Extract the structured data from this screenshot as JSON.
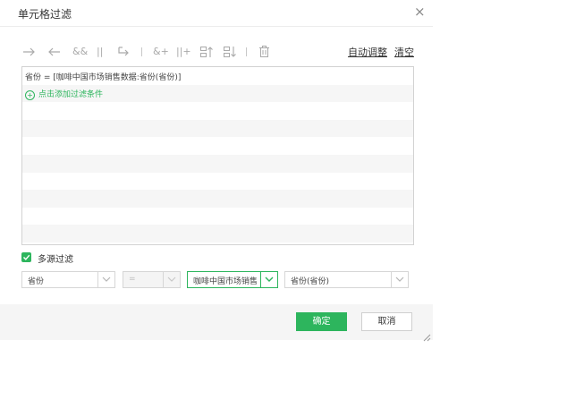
{
  "dialog": {
    "title": "单元格过滤",
    "close_glyph": "×"
  },
  "toolbar": {
    "icons": [
      "arrow-right-icon",
      "arrow-left-icon",
      "and-icon",
      "or-icon",
      "indent-icon",
      "add-and-icon",
      "add-or-icon",
      "move-up-icon",
      "move-down-icon",
      "delete-icon"
    ],
    "glyphs": {
      "and": "&&",
      "or": "||",
      "add_and": "&+",
      "add_or": "||+"
    },
    "auto_adjust": "自动调整",
    "clear": "清空"
  },
  "conditions": {
    "expression": "省份 = [咖啡中国市场销售数据:省份(省份)]",
    "add_link": "点击添加过滤条件"
  },
  "multi_source": {
    "label": "多源过滤",
    "checked": true
  },
  "filter_row": {
    "field": "省份",
    "operator": "=",
    "dataset": "咖啡中国市场销售",
    "dataset_field": "省份(省份)"
  },
  "buttons": {
    "ok": "确定",
    "cancel": "取消"
  },
  "colors": {
    "accent": "#2db55d",
    "icon": "#a9a9a9",
    "border": "#d2d2d2"
  }
}
